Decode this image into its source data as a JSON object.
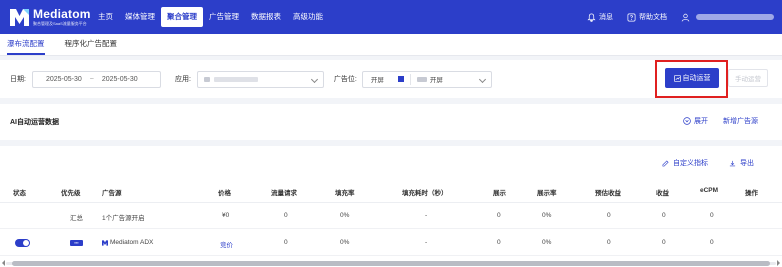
{
  "brand": {
    "name": "Mediatom",
    "subtitle": "聚合管理及SaaS流量服务平台",
    "colors": {
      "primary": "#2c3ec9",
      "highlight_border": "#e02020"
    }
  },
  "nav": {
    "items": [
      "主页",
      "媒体管理",
      "聚合管理",
      "广告管理",
      "数据报表",
      "高级功能"
    ],
    "active": "聚合管理"
  },
  "topright": {
    "messages": "消息",
    "help": "帮助文档",
    "icons": [
      "bell-icon",
      "help-icon",
      "user-icon"
    ]
  },
  "subtabs": {
    "items": [
      "瀑布流配置",
      "程序化广告配置"
    ],
    "active": "瀑布流配置"
  },
  "filters": {
    "date_label": "日期:",
    "date_start": "2025-05-30",
    "date_sep": "~",
    "date_end": "2025-05-30",
    "app_label": "应用:",
    "slot_label": "广告位:",
    "slot_type": "开屏",
    "slot_value": "开屏",
    "auto_button": "自动运营",
    "manual_button": "手动运营"
  },
  "ai_panel": {
    "title": "AI自动运营数据",
    "expand": "展开",
    "add_source": "新增广告源"
  },
  "table": {
    "custom_metrics": "自定义指标",
    "export": "导出",
    "columns": [
      "状态",
      "优先级",
      "广告源",
      "价格",
      "流量请求",
      "填充率",
      "填充耗时（秒）",
      "展示",
      "展示率",
      "预估收益",
      "收益",
      "eCPM",
      "操作"
    ],
    "rows": [
      {
        "status": "",
        "priority": "汇总",
        "source": "1个广告源开启",
        "price": "¥0",
        "requests": "0",
        "fill_rate": "0%",
        "fill_time": "-",
        "impressions": "0",
        "imp_rate": "0%",
        "est_revenue": "0",
        "revenue": "0",
        "ecpm": "0",
        "action": ""
      },
      {
        "status": "on",
        "priority": "",
        "source": "Mediatom ADX",
        "price": "竞价",
        "requests": "0",
        "fill_rate": "0%",
        "fill_time": "-",
        "impressions": "0",
        "imp_rate": "0%",
        "est_revenue": "0",
        "revenue": "0",
        "ecpm": "0",
        "action": ""
      }
    ]
  }
}
